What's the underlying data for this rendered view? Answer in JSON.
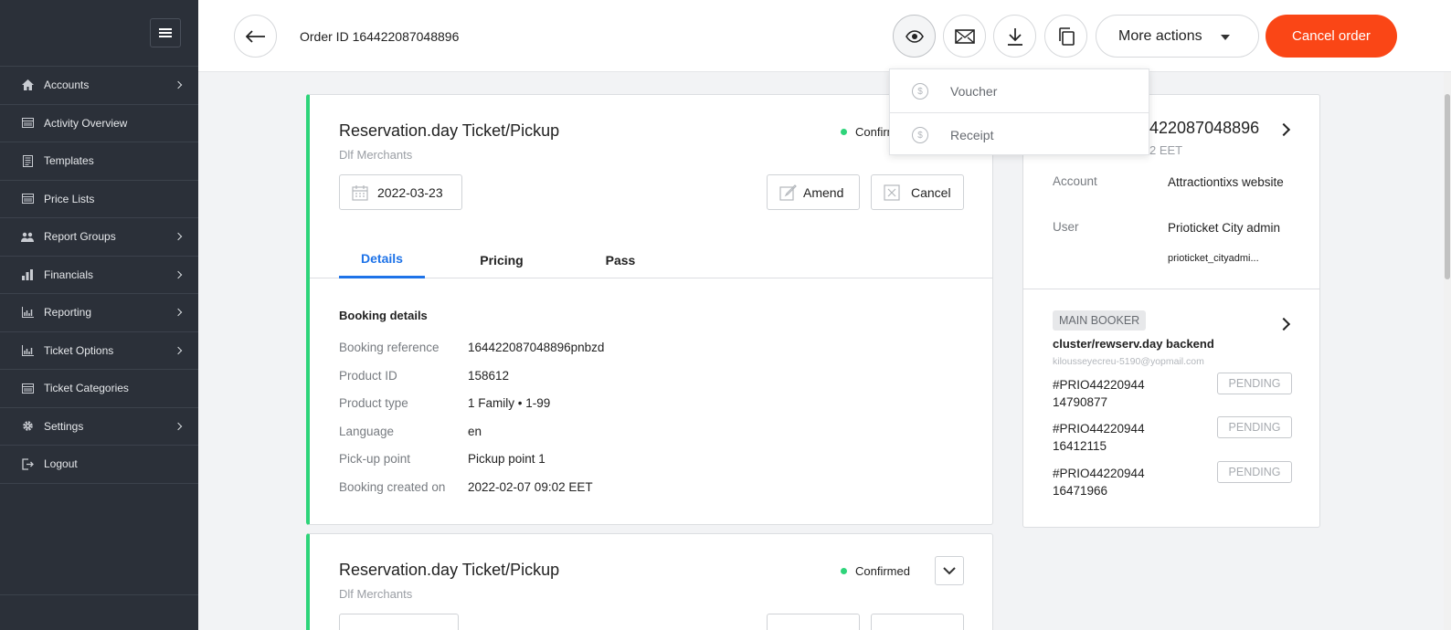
{
  "sidebar": {
    "items": [
      {
        "label": "Accounts",
        "icon": "home-icon",
        "has_submenu": true
      },
      {
        "label": "Activity Overview",
        "icon": "list-icon",
        "has_submenu": false
      },
      {
        "label": "Templates",
        "icon": "document-icon",
        "has_submenu": false
      },
      {
        "label": "Price Lists",
        "icon": "list-icon",
        "has_submenu": false
      },
      {
        "label": "Report Groups",
        "icon": "users-icon",
        "has_submenu": true
      },
      {
        "label": "Financials",
        "icon": "bar-chart-icon",
        "has_submenu": true
      },
      {
        "label": "Reporting",
        "icon": "chart-icon",
        "has_submenu": true
      },
      {
        "label": "Ticket Options",
        "icon": "chart-icon",
        "has_submenu": true
      },
      {
        "label": "Ticket Categories",
        "icon": "list-icon",
        "has_submenu": false
      },
      {
        "label": "Settings",
        "icon": "gear-icon",
        "has_submenu": true
      },
      {
        "label": "Logout",
        "icon": "logout-icon",
        "has_submenu": false
      }
    ]
  },
  "header": {
    "order_id": "Order ID 164422087048896",
    "more_actions": "More actions",
    "cancel_order": "Cancel order"
  },
  "dropdown": {
    "items": [
      "Voucher",
      "Receipt"
    ]
  },
  "card1": {
    "title": "Reservation.day Ticket/Pickup",
    "merchant": "Dlf Merchants",
    "status": "Confirmed",
    "date": "2022-03-23",
    "amend": "Amend",
    "cancel": "Cancel",
    "tabs": [
      "Details",
      "Pricing",
      "Pass"
    ],
    "section_title": "Booking details",
    "details": [
      {
        "label": "Booking reference",
        "value": "164422087048896pnbzd"
      },
      {
        "label": "Product ID",
        "value": "158612"
      },
      {
        "label": "Product type",
        "value": "1 Family • 1-99"
      },
      {
        "label": "Language",
        "value": "en"
      },
      {
        "label": "Pick-up point",
        "value": "Pickup point 1"
      },
      {
        "label": "Booking created on",
        "value": "2022-02-07 09:02 EET"
      }
    ]
  },
  "card2": {
    "title": "Reservation.day Ticket/Pickup",
    "merchant": "Dlf Merchants",
    "status": "Confirmed"
  },
  "right_panel": {
    "order_number_partial": "422087048896",
    "time_partial": "2 EET",
    "account_label": "Account",
    "account_value": "Attractiontixs website",
    "user_label": "User",
    "user_value": "Prioticket City admin",
    "user_login": "prioticket_cityadmi...",
    "main_booker_badge": "MAIN BOOKER",
    "booker_name": "cluster/rewserv.day backend",
    "booker_email": "kilousseyecreu-5190@yopmail.com",
    "tickets": [
      {
        "line1": "#PRIO44220944",
        "line2": "14790877",
        "status": "PENDING"
      },
      {
        "line1": "#PRIO44220944",
        "line2": "16412115",
        "status": "PENDING"
      },
      {
        "line1": "#PRIO44220944",
        "line2": "16471966",
        "status": "PENDING"
      }
    ]
  },
  "colors": {
    "sidebar_bg": "#2b3039",
    "accent_orange": "#fa4616",
    "confirmed_green": "#2ed47a",
    "tab_blue": "#1e73e8"
  }
}
